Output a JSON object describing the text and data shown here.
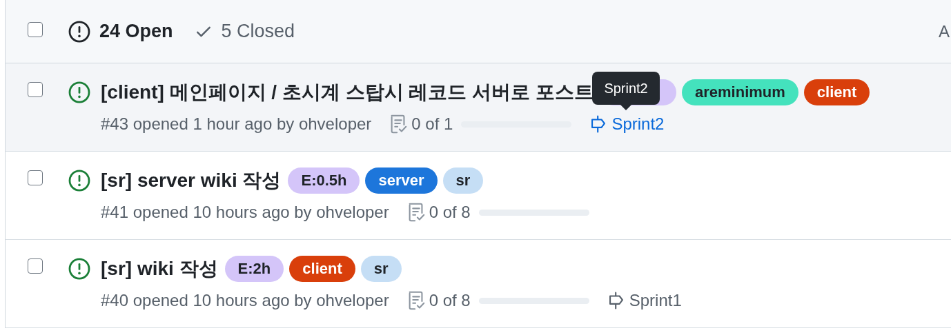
{
  "header": {
    "select_all": {
      "checked": false
    },
    "open": {
      "label": "24 Open",
      "selected": true
    },
    "closed": {
      "label": "5 Closed",
      "selected": false
    },
    "right_text": "A"
  },
  "issues": [
    {
      "checked": false,
      "hovered": true,
      "title": "[client] 메인페이지 / 초시계 스탑시 레코드 서버로 포스트",
      "labels": [
        {
          "color": "#d4c5f9"
        },
        {
          "text": "areminimum",
          "color": "#44e2bd"
        },
        {
          "text": "client",
          "color": "#d93f0b"
        }
      ],
      "meta": "#43 opened 1 hour ago by ohveloper",
      "tasks": "0 of 1",
      "level": 0,
      "milestone": {
        "text": "Sprint2",
        "hovered": true
      },
      "tooltip": "Sprint2"
    },
    {
      "checked": false,
      "hovered": false,
      "title": "[sr] server wiki 작성",
      "labels": [
        {
          "text": "E:0.5h",
          "color": "#d4c5f9"
        },
        {
          "text": "server",
          "color": "#1d76db"
        },
        {
          "text": "sr",
          "color": "#c5def5"
        }
      ],
      "meta": "#41 opened 10 hours ago by ohveloper",
      "tasks": "0 of 8",
      "level": 0
    },
    {
      "checked": false,
      "hovered": false,
      "title": "[sr] wiki 작성",
      "labels": [
        {
          "text": "E:2h",
          "color": "#d4c5f9"
        },
        {
          "text": "client",
          "color": "#d93f0b"
        },
        {
          "text": "sr",
          "color": "#c5def5"
        }
      ],
      "meta": "#40 opened 10 hours ago by ohveloper",
      "tasks": "0 of 8",
      "level": 0,
      "milestone": {
        "text": "Sprint1",
        "hovered": false
      }
    }
  ]
}
